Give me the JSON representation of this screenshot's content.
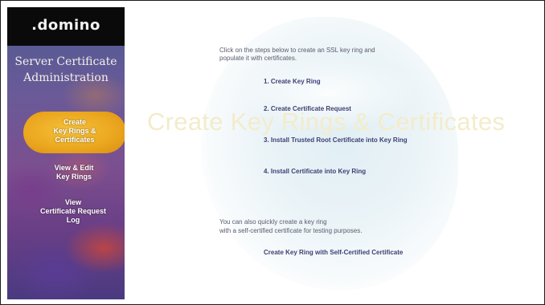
{
  "sidebar": {
    "logo": ".domino",
    "title_line1": "Server Certificate",
    "title_line2": "Administration",
    "nav": [
      {
        "lines": [
          "Create",
          "Key Rings &",
          "Certificates"
        ]
      },
      {
        "lines": [
          "View & Edit",
          "Key Rings"
        ]
      },
      {
        "lines": [
          "View",
          "Certificate Request",
          "Log"
        ]
      }
    ]
  },
  "main": {
    "watermark": "Create Key Rings & Certificates",
    "intro_line1": "Click on the steps below to create an SSL key ring and",
    "intro_line2": "populate it with certificates.",
    "steps": [
      "1. Create Key Ring",
      "2. Create Certificate Request",
      "3. Install Trusted Root Certificate into Key Ring",
      "4. Install Certificate into Key Ring"
    ],
    "also_line1": "You can also quickly create a key ring",
    "also_line2": "with a self-certified certificate for testing purposes.",
    "self_certified_link": "Create Key Ring with Self-Certified Certificate"
  }
}
